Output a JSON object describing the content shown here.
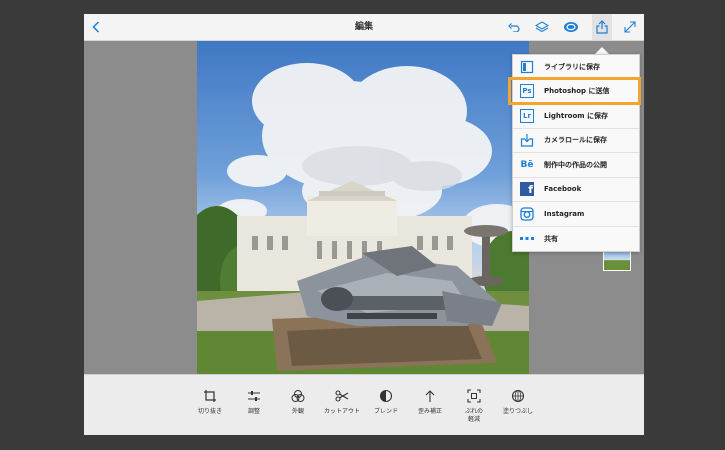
{
  "header": {
    "title": "編集"
  },
  "toolbar": {
    "icons": [
      "back-chevron-icon",
      "undo-icon",
      "layers-icon",
      "creative-cloud-icon",
      "share-icon",
      "fullscreen-icon"
    ]
  },
  "tools": [
    {
      "label": "切り抜き",
      "icon": "crop-icon"
    },
    {
      "label": "調整",
      "icon": "adjust-sliders-icon"
    },
    {
      "label": "外観",
      "icon": "looks-icon"
    },
    {
      "label": "カットアウト",
      "icon": "scissors-icon"
    },
    {
      "label": "ブレンド",
      "icon": "blend-icon"
    },
    {
      "label": "歪み補正",
      "icon": "perspective-icon"
    },
    {
      "label": "ぶれの",
      "label2": "軽減",
      "icon": "shake-reduction-icon"
    },
    {
      "label": "塗りつぶし",
      "icon": "fill-icon"
    }
  ],
  "share_menu": {
    "items": [
      {
        "label": "ライブラリに保存",
        "icon": "library-icon"
      },
      {
        "label": "Photoshop に送信",
        "icon": "photoshop-icon",
        "badge": "Ps"
      },
      {
        "label": "Lightroom に保存",
        "icon": "lightroom-icon",
        "badge": "Lr"
      },
      {
        "label": "カメラロールに保存",
        "icon": "camera-roll-icon"
      },
      {
        "label": "制作中の作品の公開",
        "icon": "behance-icon",
        "badge": "Bē"
      },
      {
        "label": "Facebook",
        "icon": "facebook-icon",
        "badge": "f"
      },
      {
        "label": "Instagram",
        "icon": "instagram-icon"
      },
      {
        "label": "共有",
        "icon": "more-icon"
      }
    ],
    "highlighted_index": 1
  },
  "colors": {
    "accent": "#1e7fd6",
    "highlight": "#f2a531",
    "photoshop": "#1e7fd6",
    "facebook": "#2d5aa0"
  }
}
